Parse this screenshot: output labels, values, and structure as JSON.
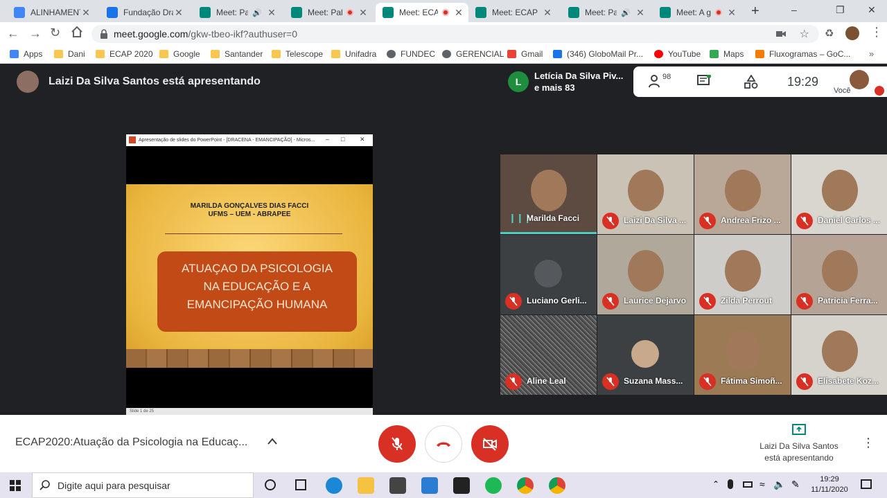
{
  "browser": {
    "tabs": [
      {
        "title": "ALINHAMENTO",
        "fav": "docs-icon",
        "color": "#4285f4",
        "indicator": "none"
      },
      {
        "title": "Fundação Dracena",
        "fav": "calendar-icon",
        "color": "#1a73e8",
        "indicator": "none"
      },
      {
        "title": "Meet: Palestra",
        "fav": "meet-icon",
        "color": "#00897b",
        "indicator": "audio"
      },
      {
        "title": "Meet: Palestra",
        "fav": "meet-icon",
        "color": "#00897b",
        "indicator": "recording"
      },
      {
        "title": "Meet: ECAP",
        "fav": "meet-icon",
        "color": "#00897b",
        "indicator": "recording"
      },
      {
        "title": "Meet: ECAP",
        "fav": "meet-icon",
        "color": "#00897b",
        "indicator": "none"
      },
      {
        "title": "Meet: Palestra",
        "fav": "meet-icon",
        "color": "#00897b",
        "indicator": "audio"
      },
      {
        "title": "Meet: A gestão",
        "fav": "meet-icon",
        "color": "#00897b",
        "indicator": "recording"
      }
    ],
    "active_tab_index": 4,
    "url_domain": "meet.google.com",
    "url_path": "/gkw-tbeo-ikf?authuser=0",
    "bookmarks": [
      {
        "label": "Apps",
        "icon": "apps-grid-icon"
      },
      {
        "label": "Dani",
        "icon": "folder-icon"
      },
      {
        "label": "ECAP 2020",
        "icon": "folder-icon"
      },
      {
        "label": "Google",
        "icon": "folder-icon"
      },
      {
        "label": "Santander",
        "icon": "folder-icon"
      },
      {
        "label": "Telescope",
        "icon": "folder-icon"
      },
      {
        "label": "Unifadra",
        "icon": "folder-icon"
      },
      {
        "label": "FUNDEC",
        "icon": "globe-icon"
      },
      {
        "label": "GERENCIAL",
        "icon": "globe-icon"
      },
      {
        "label": "Gmail",
        "icon": "gmail-icon"
      },
      {
        "label": "(346) GloboMail Pr...",
        "icon": "globomail-icon"
      },
      {
        "label": "YouTube",
        "icon": "youtube-icon"
      },
      {
        "label": "Maps",
        "icon": "maps-icon"
      },
      {
        "label": "Fluxogramas – GoC...",
        "icon": "lucidchart-icon"
      }
    ]
  },
  "meet": {
    "presenter_banner": "Laizi Da Silva Santos está apresentando",
    "pinned_name_line1": "Letícia Da Silva Piv...",
    "pinned_name_line2": "e mais 83",
    "pinned_initial": "L",
    "participant_count": "98",
    "clock": "19:29",
    "self_label": "Você",
    "slide": {
      "window_title": "Apresentação de slides do PowerPoint - [DRACENA - EMANCIPAÇÃO] - Micros...",
      "author_line1": "MARILDA GONÇALVES DIAS FACCI",
      "author_line2": "UFMS – UEM - ABRAPEE",
      "title_line1": "ATUAÇAO DA PSICOLOGIA",
      "title_line2": "NA EDUCAÇÃO E A",
      "title_line3": "EMANCIPAÇÃO HUMANA",
      "status": "Slide 1 de 25"
    },
    "tiles": [
      {
        "name": "Marilda Facci",
        "bg": "#5d4a40",
        "speaking": true
      },
      {
        "name": "Laizi Da Silva ...",
        "bg": "#c9c2b5",
        "speaking": false
      },
      {
        "name": "Andrea Frizo ...",
        "bg": "#b9a898",
        "speaking": false
      },
      {
        "name": "Daniel Carlos ...",
        "bg": "#d9d6d0",
        "speaking": false
      },
      {
        "name": "Luciano Gerli...",
        "bg": "#3c4043",
        "speaking": false
      },
      {
        "name": "Laurice Dejarvo",
        "bg": "#b0a89a",
        "speaking": false
      },
      {
        "name": "Zilda Perrout",
        "bg": "#cfcdc9",
        "speaking": false
      },
      {
        "name": "Patricia Ferra...",
        "bg": "#b5a496",
        "speaking": false
      },
      {
        "name": "Aline Leal",
        "bg": "#6e6e6e",
        "speaking": false
      },
      {
        "name": "Suzana Mass...",
        "bg": "#3c4043",
        "speaking": false
      },
      {
        "name": "Fátima Simoñ...",
        "bg": "#9c7a55",
        "speaking": false
      },
      {
        "name": "Elisabete Koz...",
        "bg": "#d6d2cc",
        "speaking": false
      }
    ],
    "meeting_title": "ECAP2020:Atuação da Psicologia na Educaç...",
    "present_line1": "Laizi Da Silva Santos",
    "present_line2": "está apresentando"
  },
  "taskbar": {
    "search_placeholder": "Digite aqui para pesquisar",
    "time": "19:29",
    "date": "11/11/2020"
  },
  "colors": {
    "meet_bg": "#202124",
    "danger": "#d93025",
    "speaking": "#4ecdc4"
  }
}
